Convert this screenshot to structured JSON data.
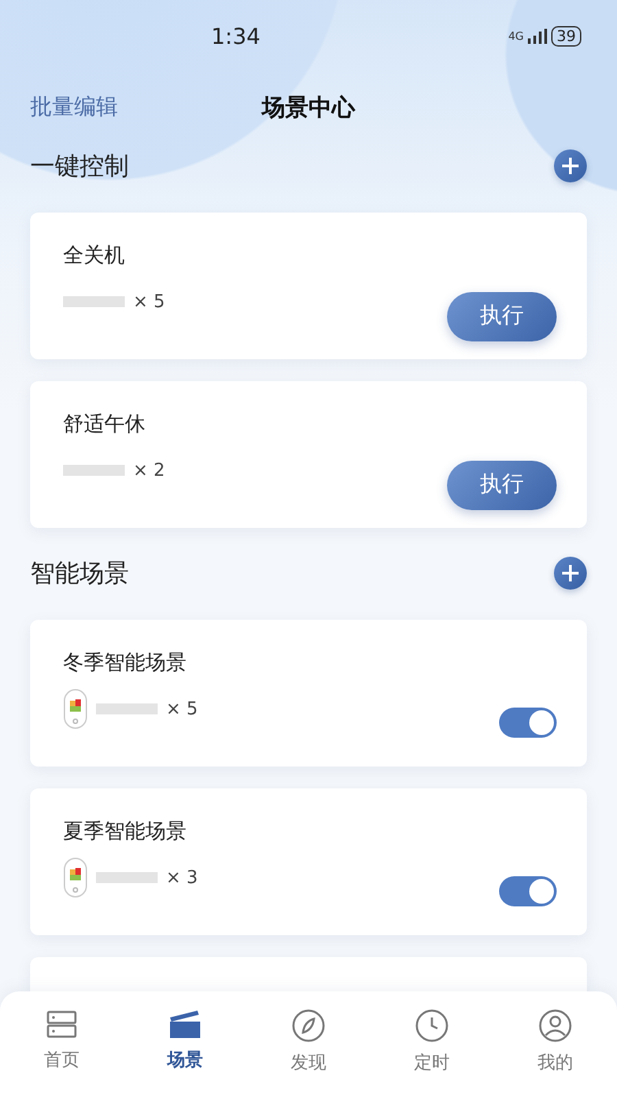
{
  "status_bar": {
    "time": "1:34",
    "network": "4G",
    "battery": "39"
  },
  "header": {
    "left_action": "批量编辑",
    "title": "场景中心"
  },
  "sections": [
    {
      "title": "一键控制",
      "kind": "manual",
      "scenes": [
        {
          "name": "全关机",
          "count": "× 5",
          "action": "执行"
        },
        {
          "name": "舒适午休",
          "count": "× 2",
          "action": "执行"
        }
      ]
    },
    {
      "title": "智能场景",
      "kind": "smart",
      "scenes": [
        {
          "name": "冬季智能场景",
          "count": "× 5",
          "on": true
        },
        {
          "name": "夏季智能场景",
          "count": "× 3",
          "on": true
        }
      ]
    }
  ],
  "tab_bar": [
    {
      "label": "首页",
      "kind": "home",
      "selected": false
    },
    {
      "label": "场景",
      "kind": "scene",
      "selected": true
    },
    {
      "label": "发现",
      "kind": "discover",
      "selected": false
    },
    {
      "label": "定时",
      "kind": "timer",
      "selected": false
    },
    {
      "label": "我的",
      "kind": "profile",
      "selected": false
    }
  ]
}
